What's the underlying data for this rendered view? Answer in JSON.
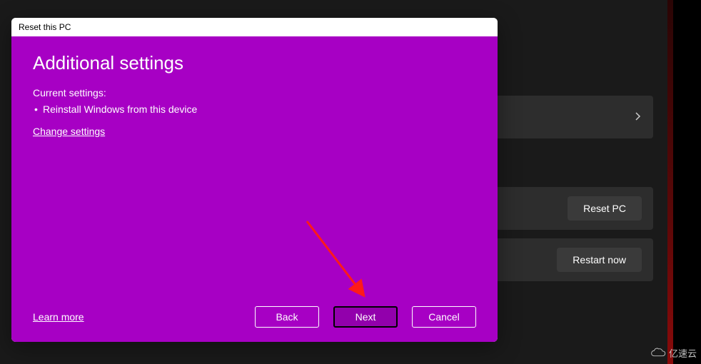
{
  "dialog": {
    "title": "Reset this PC",
    "heading": "Additional settings",
    "current_settings_label": "Current settings:",
    "settings_items": {
      "0": "Reinstall Windows from this device"
    },
    "change_settings_label": "Change settings",
    "learn_more_label": "Learn more",
    "buttons": {
      "back": "Back",
      "next": "Next",
      "cancel": "Cancel"
    }
  },
  "background": {
    "reset_pc_button": "Reset PC",
    "restart_now_button": "Restart now"
  },
  "watermark": {
    "text": "亿速云"
  }
}
